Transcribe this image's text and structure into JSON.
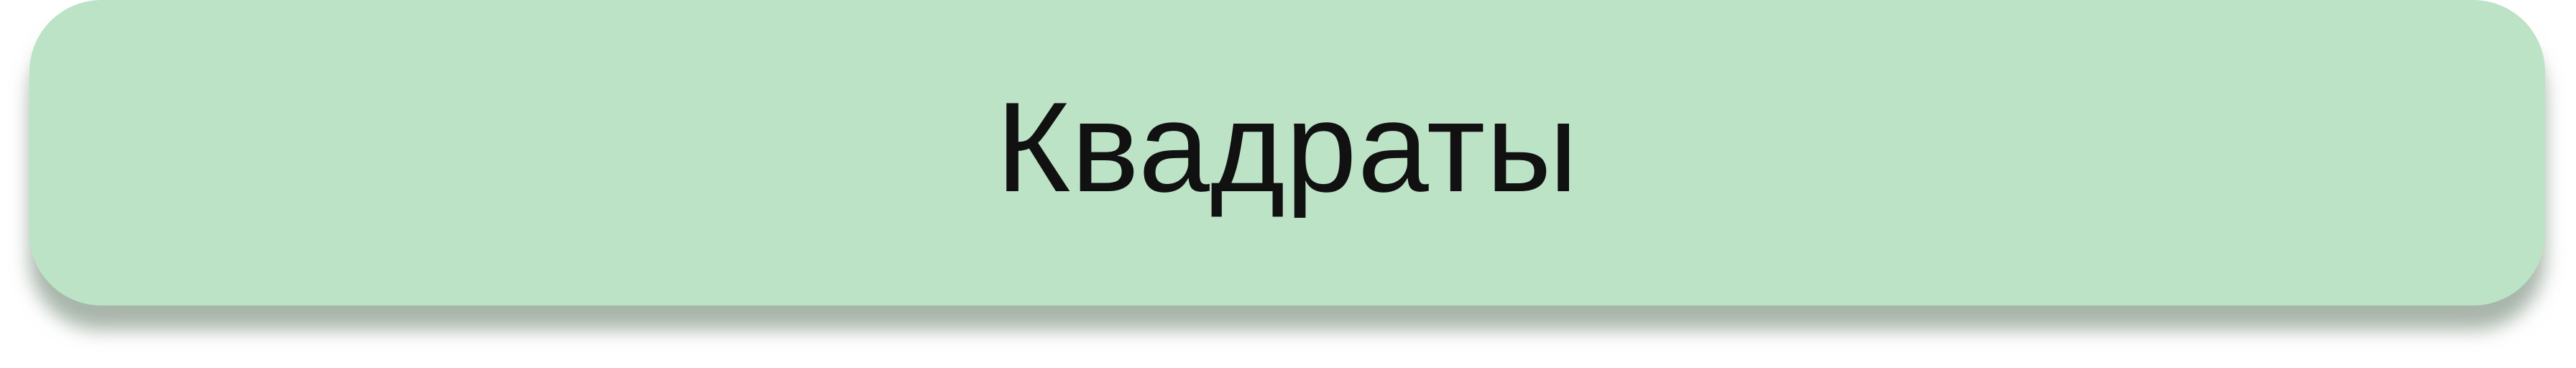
{
  "button": {
    "label": "Квадраты",
    "background_color": "#bce3c6",
    "text_color": "#111111"
  }
}
